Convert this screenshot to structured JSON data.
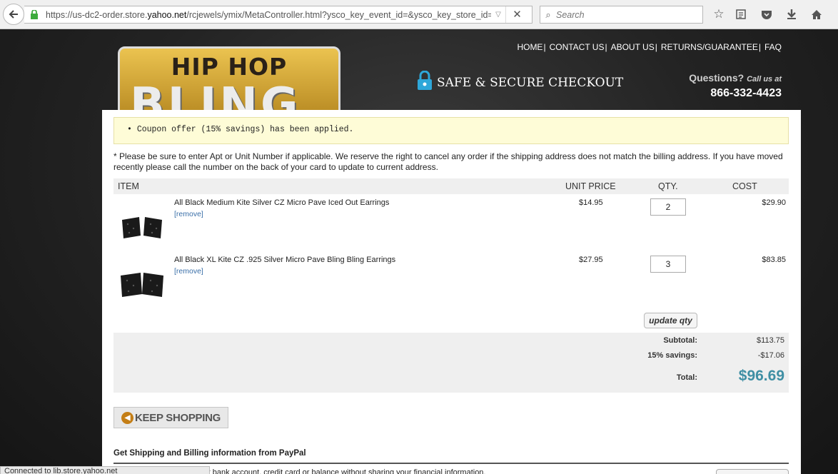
{
  "browser": {
    "url_prefix": "https://us-dc2-order.store.",
    "url_domain": "yahoo.net",
    "url_suffix": "/rcjewels/ymix/MetaController.html?ysco_key_event_id=&ysco_key_store_id=rcje",
    "search_placeholder": "Search",
    "status_text": "Connected to lib.store.yahoo.net"
  },
  "header": {
    "logo_line1": "HIP HOP",
    "logo_line2": "BLING",
    "nav": [
      "HOME",
      "CONTACT US",
      "ABOUT US",
      "RETURNS/GUARANTEE",
      "FAQ"
    ],
    "secure_text": "SAFE & SECURE CHECKOUT",
    "questions": "Questions?",
    "call_us": "Call us at",
    "phone": "866-332-4423"
  },
  "cart": {
    "coupon_message": "Coupon offer (15% savings) has been applied.",
    "notice": "* Please be sure to enter Apt or Unit Number if applicable. We reserve the right to cancel any order if the shipping address does not match the billing address. If you have moved recently please call the number on the back of your card to update to current address.",
    "columns": {
      "item": "ITEM",
      "unit_price": "UNIT PRICE",
      "qty": "QTY.",
      "cost": "COST"
    },
    "items": [
      {
        "name": "All Black Medium Kite Silver CZ Micro Pave Iced Out Earrings",
        "remove": "[remove]",
        "price": "$14.95",
        "qty": "2",
        "cost": "$29.90"
      },
      {
        "name": "All Black XL Kite CZ .925 Silver Micro Pave Bling Bling Earrings",
        "remove": "[remove]",
        "price": "$27.95",
        "qty": "3",
        "cost": "$83.85"
      }
    ],
    "update_label": "update qty",
    "subtotal_label": "Subtotal:",
    "subtotal": "$113.75",
    "savings_label": "15% savings:",
    "savings": "-$17.06",
    "total_label": "Total:",
    "total": "$96.69",
    "keep_shopping": "KEEP SHOPPING",
    "paypal_title": "Get Shipping and Billing information from PayPal",
    "paypal_text": "r bank account, credit card or balance without sharing your financial information."
  },
  "colors": {
    "link": "#3a6fa8",
    "total": "#3f8fa4",
    "coupon_bg": "#fefcd7",
    "secure_icon": "#2ea7d9"
  }
}
